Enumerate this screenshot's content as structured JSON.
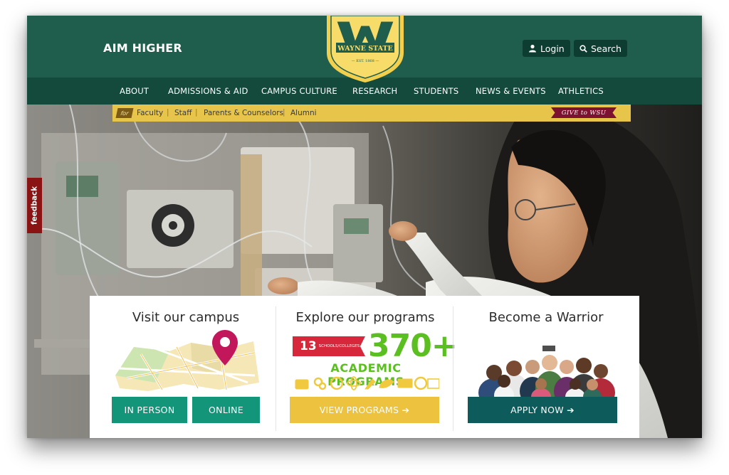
{
  "header": {
    "tagline": "AIM HIGHER",
    "logo_text": "WAYNE STATE",
    "logo_est": "— EST. 1868 —",
    "login_label": "Login",
    "search_label": "Search"
  },
  "nav": {
    "items": [
      {
        "label": "ABOUT"
      },
      {
        "label": "ADMISSIONS & AID"
      },
      {
        "label": "CAMPUS CULTURE"
      },
      {
        "label": "RESEARCH"
      },
      {
        "label": "STUDENTS"
      },
      {
        "label": "NEWS & EVENTS"
      },
      {
        "label": "ATHLETICS"
      }
    ]
  },
  "audience": {
    "for_label": "for",
    "links": [
      {
        "label": "Faculty"
      },
      {
        "label": "Staff"
      },
      {
        "label": "Parents & Counselors"
      },
      {
        "label": "Alumni"
      }
    ],
    "give_label": "GIVE to WSU"
  },
  "feedback_label": "feedback",
  "cards": {
    "visit": {
      "title": "Visit our campus",
      "in_person_label": "IN PERSON",
      "online_label": "ONLINE"
    },
    "programs": {
      "title": "Explore our programs",
      "schools_count": "13",
      "schools_label": "SCHOOLS/COLLEGES",
      "programs_count": "370+",
      "programs_label": "ACADEMIC PROGRAMS",
      "button_label": "VIEW PROGRAMS ➔"
    },
    "warrior": {
      "title": "Become a Warrior",
      "button_label": "APPLY NOW ➔"
    }
  },
  "colors": {
    "header_green": "#1f5e4d",
    "nav_green": "#144a3c",
    "gold": "#ecc23f",
    "button_teal": "#139579",
    "button_dark": "#0e5b5b",
    "give_red": "#7d1130",
    "program_green": "#5bbf22",
    "map_pin": "#c2185b"
  }
}
